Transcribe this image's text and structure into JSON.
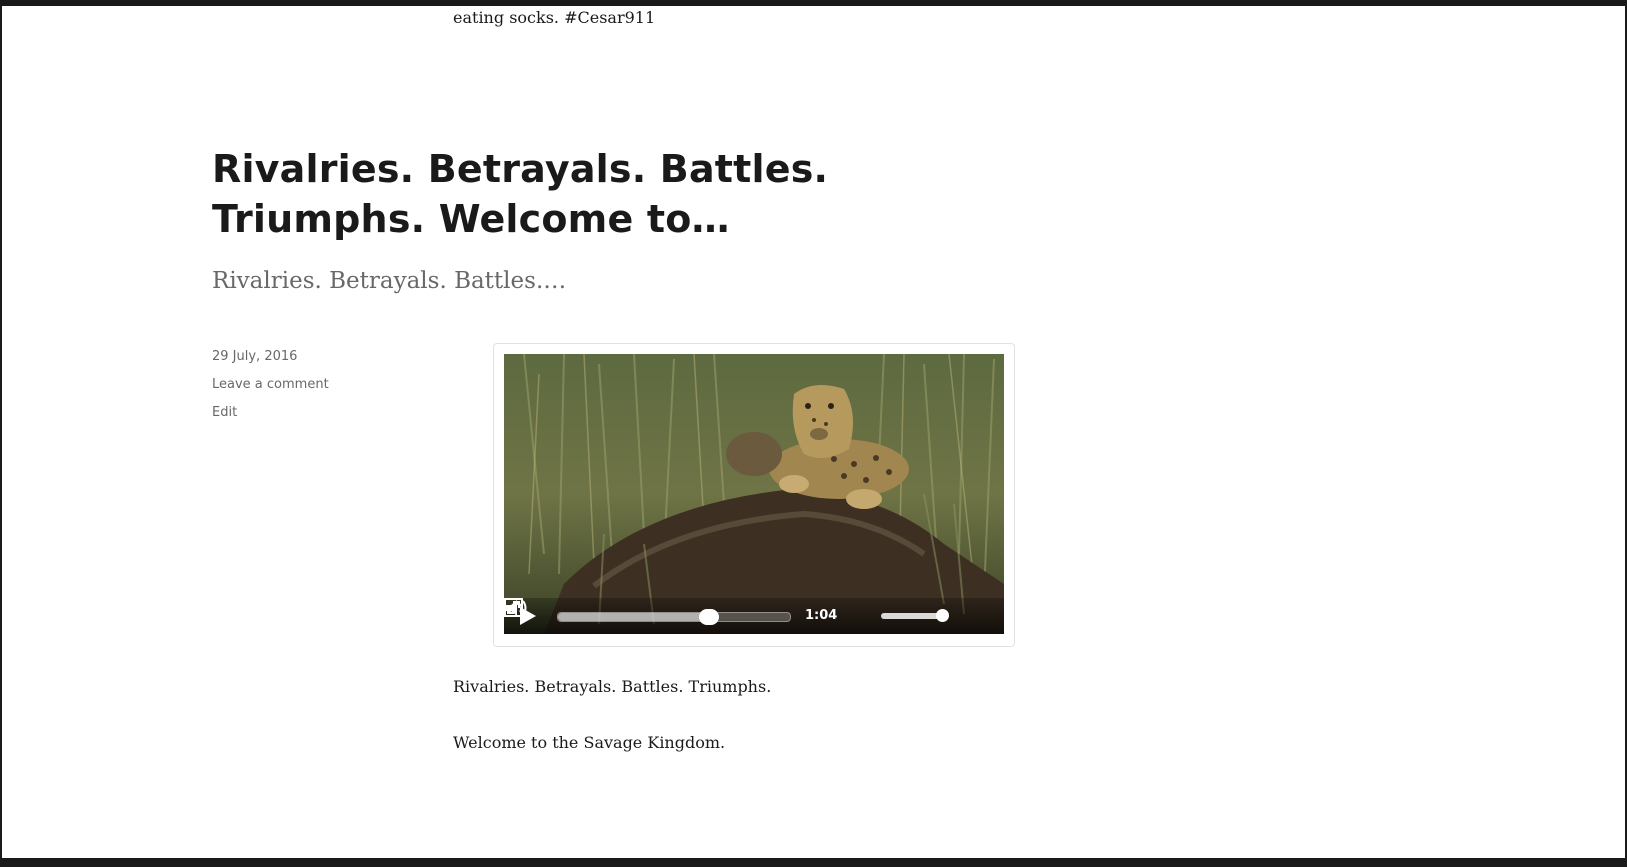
{
  "previous_post": {
    "text_tail": "eating socks. #Cesar911"
  },
  "post": {
    "title": "Rivalries. Betrayals. Battles. Triumphs. Welcome to…",
    "subtitle": "Rivalries. Betrayals. Battles.…",
    "meta": {
      "date": "29 July, 2016",
      "comments_link": "Leave a comment",
      "edit_link": "Edit"
    },
    "video": {
      "time": "1:04",
      "progress": 0.65,
      "volume": 0.93,
      "icons": {
        "play": "play-icon",
        "volume": "volume-icon",
        "fullscreen": "fullscreen-icon"
      }
    },
    "body": [
      "Rivalries. Betrayals. Battles. Triumphs.",
      "Welcome to the Savage Kingdom."
    ]
  },
  "colors": {
    "frame": "#1a1a1a",
    "text": "#1a1a1a",
    "muted": "#686868",
    "background": "#ffffff"
  }
}
